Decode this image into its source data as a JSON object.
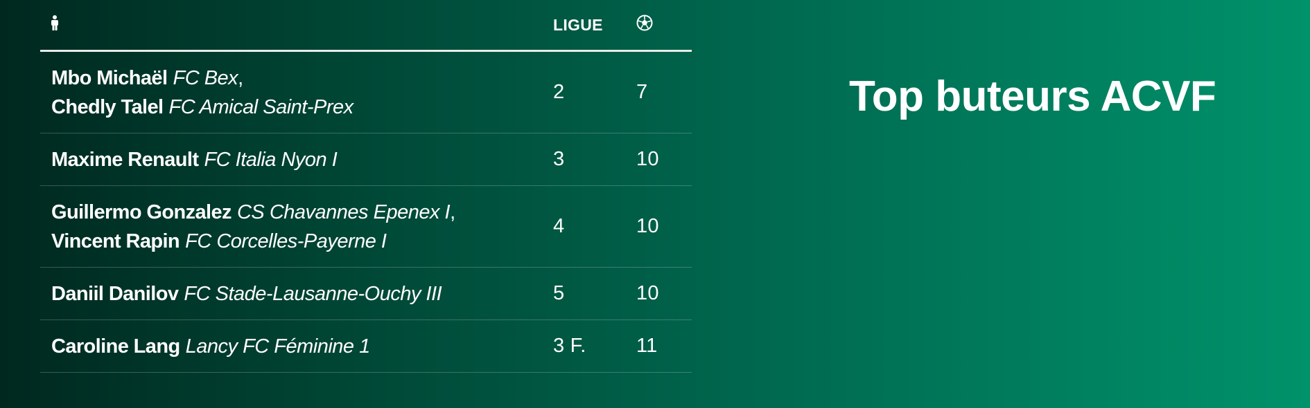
{
  "title": "Top buteurs ACVF",
  "table": {
    "headers": {
      "player_icon": "person-icon",
      "league": "LIGUE",
      "goals_icon": "soccer-ball-icon"
    },
    "rows": [
      {
        "players": [
          {
            "name": "Mbo Michaël",
            "club": "FC Bex",
            "sep": ","
          },
          {
            "name": "Chedly Talel",
            "club": "FC Amical Saint-Prex",
            "sep": ""
          }
        ],
        "league": "2",
        "goals": "7"
      },
      {
        "players": [
          {
            "name": "Maxime Renault",
            "club": "FC Italia Nyon I",
            "sep": ""
          }
        ],
        "league": "3",
        "goals": "10"
      },
      {
        "players": [
          {
            "name": "Guillermo Gonzalez",
            "club": "CS Chavannes Epenex I",
            "sep": ","
          },
          {
            "name": "Vincent Rapin",
            "club": "FC Corcelles-Payerne I",
            "sep": ""
          }
        ],
        "league": "4",
        "goals": "10"
      },
      {
        "players": [
          {
            "name": "Daniil Danilov",
            "club": "FC Stade-Lausanne-Ouchy III",
            "sep": ""
          }
        ],
        "league": "5",
        "goals": "10"
      },
      {
        "players": [
          {
            "name": "Caroline Lang",
            "club": "Lancy FC Féminine 1",
            "sep": ""
          }
        ],
        "league": "3 F.",
        "goals": "11"
      }
    ]
  },
  "colors": {
    "background_start": "#00281f",
    "background_end": "#00926a",
    "text": "#ffffff",
    "header_rule": "#e8ece9"
  }
}
